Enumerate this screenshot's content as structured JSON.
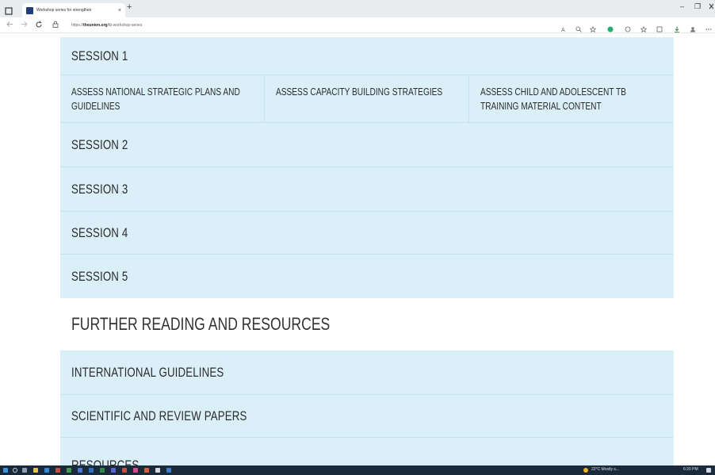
{
  "browser": {
    "tab_title": "Workshop series for strengthen",
    "tab_close": "×",
    "new_tab": "+",
    "url_prefix": "https://",
    "url_domain": "theunion.org",
    "url_path": "/tb-workshop-series",
    "minimize": "–",
    "restore": "❐"
  },
  "sessions": {
    "session1": "SESSION 1",
    "session1_items": [
      "ASSESS NATIONAL STRATEGIC PLANS AND GUIDELINES",
      "ASSESS CAPACITY BUILDING STRATEGIES",
      "ASSESS CHILD AND ADOLESCENT TB TRAINING MATERIAL CONTENT"
    ],
    "session2": "SESSION 2",
    "session3": "SESSION 3",
    "session4": "SESSION 4",
    "session5": "SESSION 5"
  },
  "further": {
    "heading": "FURTHER READING AND RESOURCES",
    "items": [
      "INTERNATIONAL GUIDELINES",
      "SCIENTIFIC AND REVIEW PAPERS",
      "RESOURCES"
    ]
  },
  "taskbar": {
    "weather": "22°C  Mostly s...",
    "time": "6:20 PM"
  },
  "colors": {
    "panel": "#dbeff9",
    "divider": "#c8e3f0",
    "text": "#2c2c2c",
    "taskbar": "#1b2a3a"
  }
}
